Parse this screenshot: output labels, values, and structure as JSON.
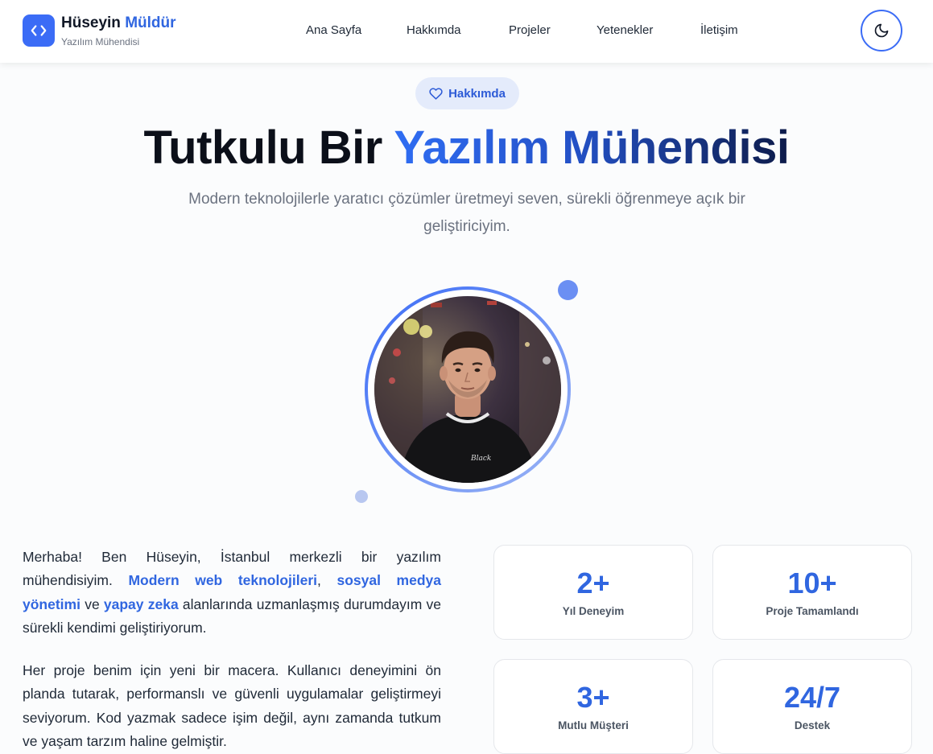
{
  "header": {
    "brand_first": "Hüseyin",
    "brand_second": "Müldür",
    "brand_subtitle": "Yazılım Mühendisi",
    "nav": [
      "Ana Sayfa",
      "Hakkımda",
      "Projeler",
      "Yetenekler",
      "İletişim"
    ],
    "logo_icon": "code-brackets-icon",
    "theme_icon": "moon-icon"
  },
  "hero": {
    "badge_label": "Hakkımda",
    "badge_icon": "heart-icon",
    "title_plain": "Tutkulu Bir",
    "title_accent": "Yazılım Mühendisi",
    "subtitle": "Modern teknolojilerle yaratıcı çözümler üretmeyi seven, sürekli öğrenmeye açık bir geliştiriciyim."
  },
  "about": {
    "p1_a": "Merhaba! Ben Hüseyin, İstanbul merkezli bir yazılım mühendisiyim. ",
    "p1_hl1": "Modern web teknolojileri",
    "p1_b": ", ",
    "p1_hl2": "sosyal medya yönetimi",
    "p1_c": " ve ",
    "p1_hl3": "yapay zeka",
    "p1_d": " alanlarında uzmanlaşmış durumdayım ve sürekli kendimi geliştiriyorum.",
    "p2": "Her proje benim için yeni bir macera. Kullanıcı deneyimini ön planda tutarak, performanslı ve güvenli uygulamalar geliştirmeyi seviyorum. Kod yazmak sadece işim değil, aynı zamanda tutkum ve yaşam tarzım haline gelmiştir."
  },
  "stats": [
    {
      "value": "2+",
      "label": "Yıl Deneyim"
    },
    {
      "value": "10+",
      "label": "Proje Tamamlandı"
    },
    {
      "value": "3+",
      "label": "Mutlu Müşteri"
    },
    {
      "value": "24/7",
      "label": "Destek"
    }
  ],
  "colors": {
    "accent": "#3066e0",
    "accent_dark": "#0d1b4a",
    "badge_bg": "#e4ebfb"
  }
}
